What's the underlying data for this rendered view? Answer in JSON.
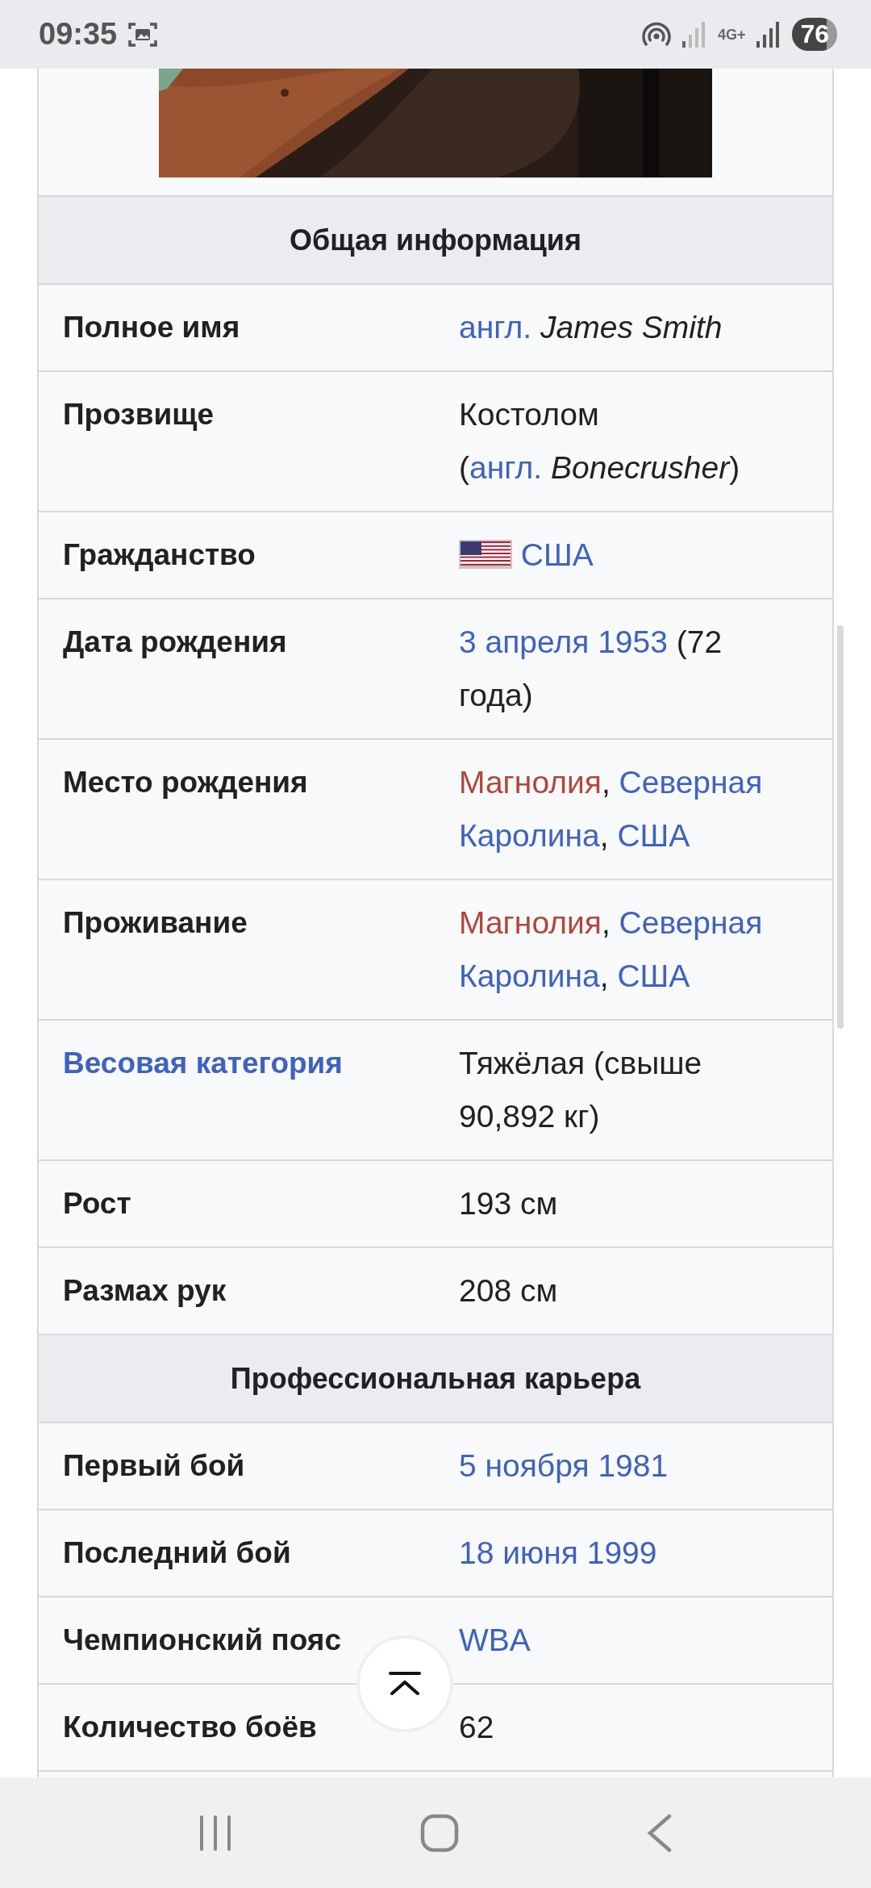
{
  "status_bar": {
    "time": "09:35",
    "network": "4G+",
    "battery": "76"
  },
  "infobox": {
    "sections": [
      {
        "title": "Общая информация",
        "rows": [
          {
            "label": "Полное имя",
            "label_link": false,
            "value": [
              {
                "kind": "link",
                "text": "англ."
              },
              {
                "kind": "space"
              },
              {
                "kind": "italic",
                "text": "James Smith"
              }
            ]
          },
          {
            "label": "Прозвище",
            "label_link": false,
            "value": [
              {
                "kind": "plain",
                "text": "Костолом"
              },
              {
                "kind": "break"
              },
              {
                "kind": "plain",
                "text": "("
              },
              {
                "kind": "link",
                "text": "англ."
              },
              {
                "kind": "space"
              },
              {
                "kind": "italic",
                "text": "Bonecrusher"
              },
              {
                "kind": "plain",
                "text": ")"
              }
            ]
          },
          {
            "label": "Гражданство",
            "label_link": false,
            "value": [
              {
                "kind": "flag"
              },
              {
                "kind": "space"
              },
              {
                "kind": "link",
                "text": "США"
              }
            ]
          },
          {
            "label": "Дата рождения",
            "label_link": false,
            "value": [
              {
                "kind": "link",
                "text": "3 апреля 1953"
              },
              {
                "kind": "plain",
                "text": " (72 года)"
              }
            ]
          },
          {
            "label": "Место рождения",
            "label_link": false,
            "value": [
              {
                "kind": "redlink",
                "text": "Магнолия"
              },
              {
                "kind": "plain",
                "text": ", "
              },
              {
                "kind": "link",
                "text": "Северная Каролина"
              },
              {
                "kind": "plain",
                "text": ", "
              },
              {
                "kind": "link",
                "text": "США"
              }
            ]
          },
          {
            "label": "Проживание",
            "label_link": false,
            "value": [
              {
                "kind": "redlink",
                "text": "Магнолия"
              },
              {
                "kind": "plain",
                "text": ", "
              },
              {
                "kind": "link",
                "text": "Северная Каролина"
              },
              {
                "kind": "plain",
                "text": ", "
              },
              {
                "kind": "link",
                "text": "США"
              }
            ]
          },
          {
            "label": "Весовая категория",
            "label_link": true,
            "value": [
              {
                "kind": "plain",
                "text": "Тяжёлая (свыше 90,892 кг)"
              }
            ]
          },
          {
            "label": "Рост",
            "label_link": false,
            "value": [
              {
                "kind": "plain",
                "text": "193 см"
              }
            ]
          },
          {
            "label": "Размах рук",
            "label_link": false,
            "value": [
              {
                "kind": "plain",
                "text": "208 см"
              }
            ]
          }
        ]
      },
      {
        "title": "Профессиональная карьера",
        "rows": [
          {
            "label": "Первый бой",
            "label_link": false,
            "value": [
              {
                "kind": "link",
                "text": "5 ноября 1981"
              }
            ]
          },
          {
            "label": "Последний бой",
            "label_link": false,
            "value": [
              {
                "kind": "link",
                "text": "18 июня 1999"
              }
            ]
          },
          {
            "label": "Чемпионский пояс",
            "label_link": false,
            "value": [
              {
                "kind": "link",
                "text": "WBA"
              }
            ]
          },
          {
            "label": "Количество боёв",
            "label_link": false,
            "value": [
              {
                "kind": "plain",
                "text": "62"
              }
            ]
          }
        ]
      }
    ]
  }
}
